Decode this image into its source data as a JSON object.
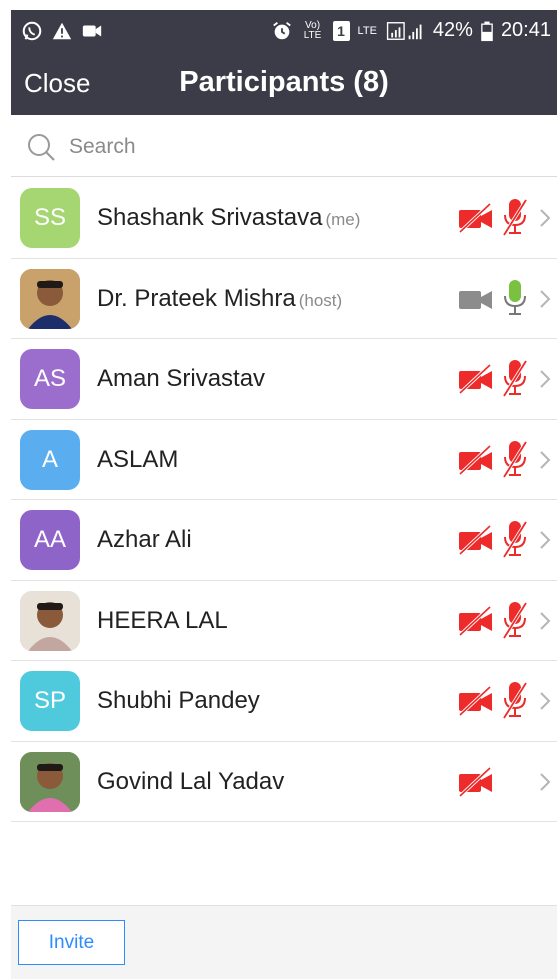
{
  "status_bar": {
    "battery": "42%",
    "time": "20:41",
    "volte": "Vo) LTE",
    "sim": "1",
    "lte": "LTE"
  },
  "header": {
    "close_label": "Close",
    "title": "Participants (8)"
  },
  "search": {
    "placeholder": "Search"
  },
  "participants": [
    {
      "initials": "SS",
      "name": "Shashank Srivastava",
      "tag": "(me)",
      "avatar_color": "#a5d672",
      "video": "off",
      "mic": "muted"
    },
    {
      "initials": "",
      "name": "Dr. Prateek Mishra",
      "tag": "(host)",
      "avatar_color": "#b07a4a",
      "video": "on",
      "mic": "on"
    },
    {
      "initials": "AS",
      "name": "Aman Srivastav",
      "tag": "",
      "avatar_color": "#9b6dcc",
      "video": "off",
      "mic": "muted"
    },
    {
      "initials": "A",
      "name": "ASLAM",
      "tag": "",
      "avatar_color": "#5aaef0",
      "video": "off",
      "mic": "muted"
    },
    {
      "initials": "AA",
      "name": "Azhar Ali",
      "tag": "",
      "avatar_color": "#8e64c9",
      "video": "off",
      "mic": "muted"
    },
    {
      "initials": "",
      "name": "HEERA LAL",
      "tag": "",
      "avatar_color": "#d9c9b8",
      "video": "off",
      "mic": "muted"
    },
    {
      "initials": "SP",
      "name": "Shubhi Pandey",
      "tag": "",
      "avatar_color": "#4fc9dc",
      "video": "off",
      "mic": "muted"
    },
    {
      "initials": "",
      "name": "Govind Lal Yadav",
      "tag": "",
      "avatar_color": "#7b8b5a",
      "video": "off",
      "mic": "none"
    }
  ],
  "footer": {
    "invite_label": "Invite"
  },
  "colors": {
    "header_bg": "#3c3c48",
    "muted_red": "#ee2b2b",
    "mic_on_green": "#7ac142",
    "accent_blue": "#2d8cff"
  }
}
